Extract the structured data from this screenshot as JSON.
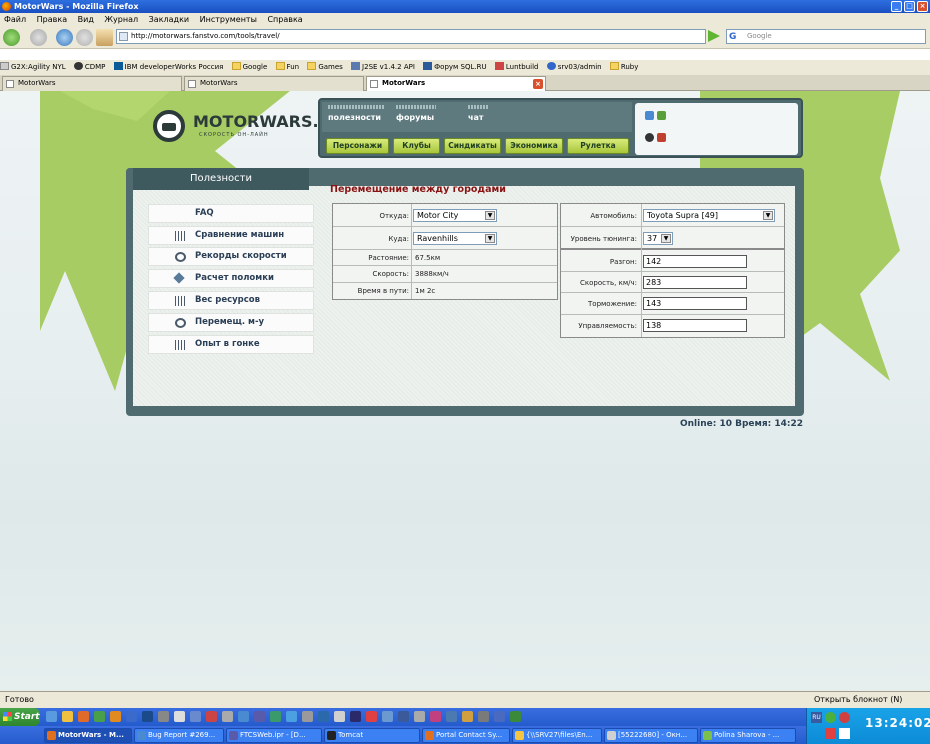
{
  "window": {
    "title": "MotorWars - Mozilla Firefox"
  },
  "menu": [
    "Файл",
    "Правка",
    "Вид",
    "Журнал",
    "Закладки",
    "Инструменты",
    "Справка"
  ],
  "nav": {
    "url": "http://motorwars.fanstvo.com/tools/travel/",
    "search_placeholder": "Google"
  },
  "bookmarks": [
    "G2X:Agility NYL",
    "CDMP",
    "IBM developerWorks Россия",
    "Google",
    "Fun",
    "Games",
    "J2SE v1.4.2 API",
    "Форум SQL.RU",
    "Luntbuild",
    "srv03/admin",
    "Ruby"
  ],
  "tabs": [
    "MotorWars",
    "MotorWars",
    "MotorWars"
  ],
  "site": {
    "logo": "MOTORWARS.RU",
    "slogan": "СКОРОСТЬ ОН-ЛАЙН",
    "topnav": [
      "полезности",
      "форумы",
      "чат"
    ],
    "buttons": [
      "Персонажи",
      "Клубы",
      "Синдикаты",
      "Экономика",
      "Рулетка"
    ],
    "section": "Полезности",
    "heading": "Перемещение между городами",
    "left_menu": [
      "FAQ",
      "Сравнение машин",
      "Рекорды скорости",
      "Расчет поломки",
      "Вес ресурсов",
      "Перемещ. м-у городами",
      "Опыт в гонке"
    ],
    "travel": {
      "from_label": "Откуда:",
      "from_value": "Motor City",
      "to_label": "Куда:",
      "to_value": "Ravenhills",
      "distance_label": "Растояние:",
      "distance_value": "67.5км",
      "speed_label": "Скорость:",
      "speed_value": "3888км/ч",
      "time_label": "Время в пути:",
      "time_value": "1м 2с"
    },
    "car": {
      "car_label": "Автомобиль:",
      "car_value": "Toyota Supra [49]",
      "tuning_label": "Уровень тюнинга:",
      "tuning_value": "37",
      "accel_label": "Разгон:",
      "accel_value": "142",
      "speed_label": "Скорость, км/ч:",
      "speed_value": "283",
      "brake_label": "Торможение:",
      "brake_value": "143",
      "handling_label": "Управляемость:",
      "handling_value": "138"
    },
    "online": "Online: 10   Время: 14:22"
  },
  "status": {
    "left": "Готово",
    "right": "Открыть блокнот (N)"
  },
  "taskbar": {
    "start": "Start",
    "tasks": [
      "MotorWars - M...",
      "Bug Report #269...",
      "FTCSWeb.ipr - [D...",
      "Tomcat",
      "Portal Contact Sy...",
      "{\\\\SRV27\\files\\En...",
      "[55222680] - Окн...",
      "Polina Sharova - ..."
    ],
    "clock": "13:24:02",
    "lang": "RU"
  }
}
